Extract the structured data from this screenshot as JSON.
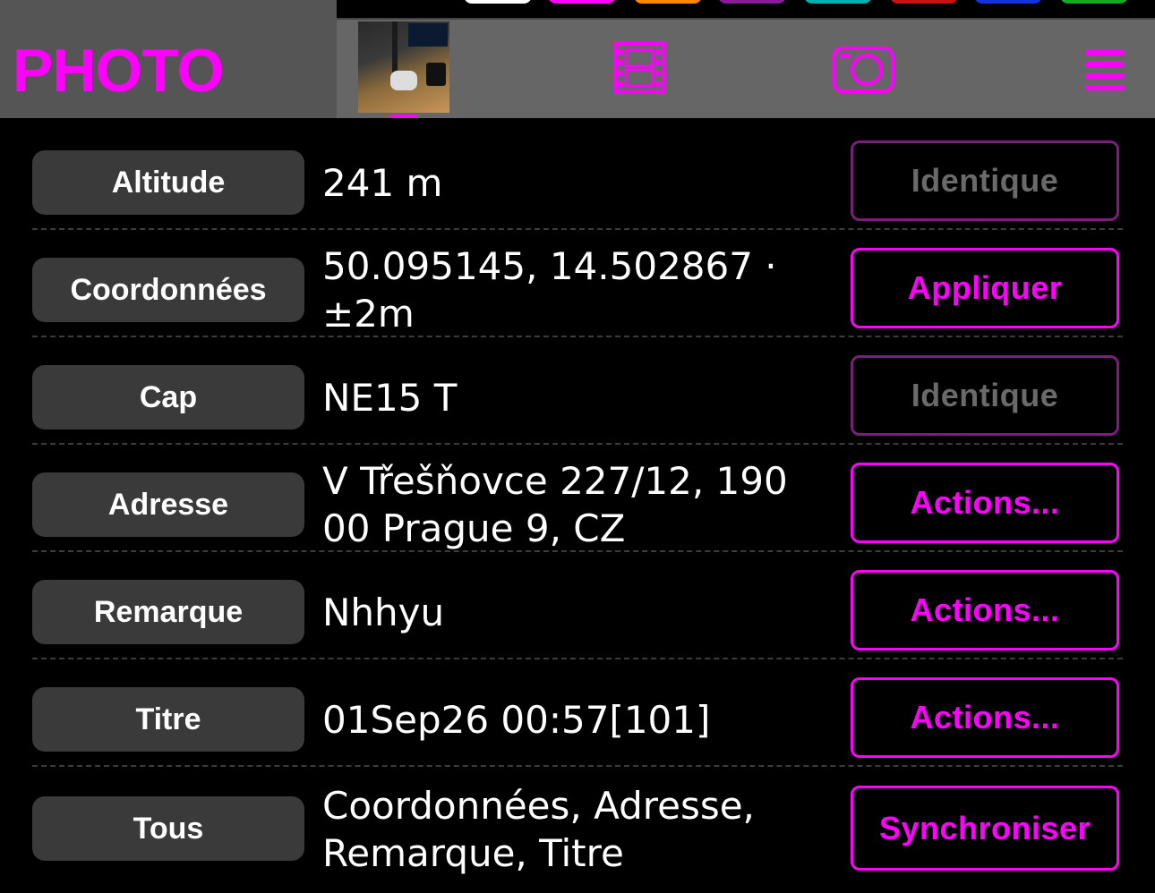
{
  "header": {
    "title": "PHOTO",
    "accent_color": "#ff00ff",
    "icons": [
      "film-icon",
      "camera-icon",
      "menu-icon"
    ]
  },
  "top_swatches": [
    "#ffffff",
    "#ff00ff",
    "#ff8800",
    "#8a1a9a",
    "#00b0b0",
    "#cc1111",
    "#1133dd",
    "#11aa22"
  ],
  "rows": [
    {
      "label": "Altitude",
      "value": "241 m",
      "action": "Identique",
      "enabled": false
    },
    {
      "label": "Coordonnées",
      "value": "50.095145, 14.502867 · ±2m",
      "action": "Appliquer",
      "enabled": true
    },
    {
      "label": "Cap",
      "value": "NE15 T",
      "action": "Identique",
      "enabled": false
    },
    {
      "label": "Adresse",
      "value": "V Třešňovce 227/12, 190 00 Prague 9, CZ",
      "action": "Actions...",
      "enabled": true
    },
    {
      "label": "Remarque",
      "value": "Nhhyu",
      "action": "Actions...",
      "enabled": true
    },
    {
      "label": "Titre",
      "value": "01Sep26 00:57[101]",
      "action": "Actions...",
      "enabled": true
    },
    {
      "label": "Tous",
      "value": "Coordonnées, Adresse, Remarque, Titre",
      "action": "Synchroniser",
      "enabled": true
    }
  ]
}
